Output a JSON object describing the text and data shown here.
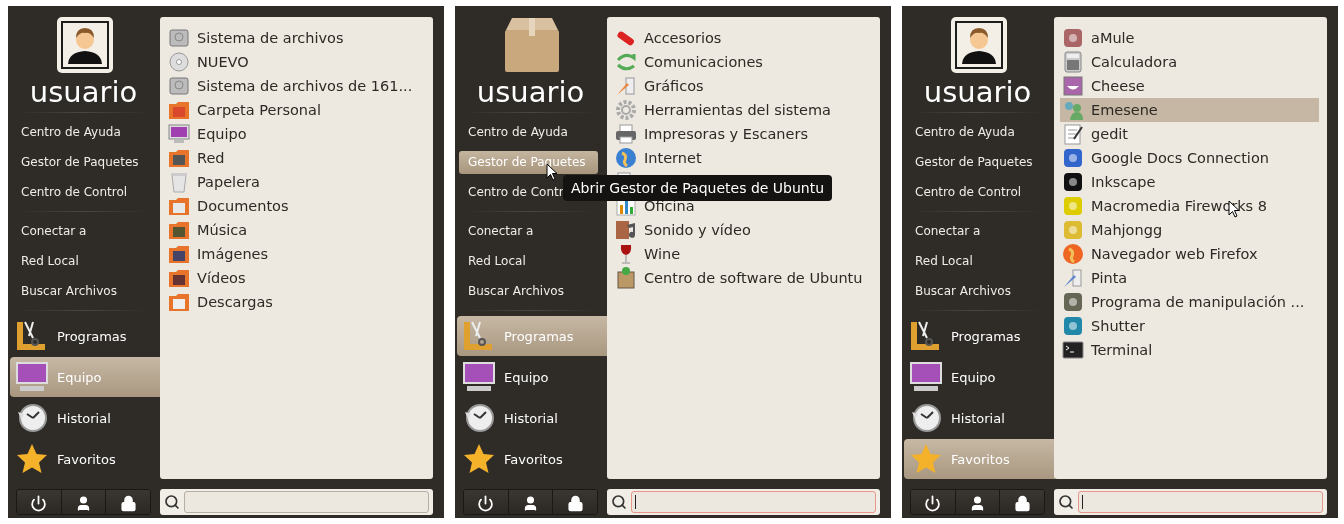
{
  "panels": [
    {
      "user": {
        "name": "usuario"
      },
      "place_groups": [
        [
          {
            "label": "Centro de Ayuda",
            "selected": false,
            "pointer": false
          },
          {
            "label": "Gestor de Paquetes",
            "selected": false,
            "pointer": false
          },
          {
            "label": "Centro de Control",
            "selected": false,
            "pointer": false
          }
        ],
        [
          {
            "label": "Conectar a",
            "selected": false,
            "pointer": false
          },
          {
            "label": "Red Local",
            "selected": false,
            "pointer": false
          },
          {
            "label": "Buscar Archivos",
            "selected": false,
            "pointer": false
          }
        ]
      ],
      "categories": [
        {
          "label": "Programas",
          "selected": false
        },
        {
          "label": "Equipo",
          "selected": true
        },
        {
          "label": "Historial",
          "selected": false
        },
        {
          "label": "Favoritos",
          "selected": false
        }
      ],
      "items": [
        {
          "label": "Sistema de archivos",
          "selected": false,
          "pointer": false
        },
        {
          "label": "NUEVO",
          "selected": false,
          "pointer": false
        },
        {
          "label": "Sistema de archivos de 161...",
          "selected": false,
          "pointer": false
        },
        {
          "label": "Carpeta Personal",
          "selected": false,
          "pointer": false
        },
        {
          "label": "Equipo",
          "selected": false,
          "pointer": false
        },
        {
          "label": "Red",
          "selected": false,
          "pointer": false
        },
        {
          "label": "Papelera",
          "selected": false,
          "pointer": false
        },
        {
          "label": "Documentos",
          "selected": false,
          "pointer": false
        },
        {
          "label": "Música",
          "selected": false,
          "pointer": false
        },
        {
          "label": "Imágenes",
          "selected": false,
          "pointer": false
        },
        {
          "label": "Vídeos",
          "selected": false,
          "pointer": false
        },
        {
          "label": "Descargas",
          "selected": false,
          "pointer": false
        }
      ],
      "search": {
        "focused": false
      }
    },
    {
      "user": {
        "name": "usuario"
      },
      "place_groups": [
        [
          {
            "label": "Centro de Ayuda",
            "selected": false,
            "pointer": false
          },
          {
            "label": "Gestor de Paquetes",
            "selected": true,
            "pointer": true
          },
          {
            "label": "Centro de Contr",
            "selected": false,
            "pointer": false
          }
        ],
        [
          {
            "label": "Conectar a",
            "selected": false,
            "pointer": false
          },
          {
            "label": "Red Local",
            "selected": false,
            "pointer": false
          },
          {
            "label": "Buscar Archivos",
            "selected": false,
            "pointer": false
          }
        ]
      ],
      "categories": [
        {
          "label": "Programas",
          "selected": true
        },
        {
          "label": "Equipo",
          "selected": false
        },
        {
          "label": "Historial",
          "selected": false
        },
        {
          "label": "Favoritos",
          "selected": false
        }
      ],
      "items": [
        {
          "label": "Accesorios",
          "selected": false,
          "pointer": false
        },
        {
          "label": "Comunicaciones",
          "selected": false,
          "pointer": false
        },
        {
          "label": "Gráficos",
          "selected": false,
          "pointer": false
        },
        {
          "label": "Herramientas del sistema",
          "selected": false,
          "pointer": false
        },
        {
          "label": "Impresoras y Escaners",
          "selected": false,
          "pointer": false
        },
        {
          "label": "Internet",
          "selected": false,
          "pointer": false
        },
        {
          "selected": false,
          "pointer": false
        },
        {
          "label": "Oficina",
          "selected": false,
          "pointer": false
        },
        {
          "label": "Sonido y vídeo",
          "selected": false,
          "pointer": false
        },
        {
          "label": "Wine",
          "selected": false,
          "pointer": false
        },
        {
          "label": "Centro de software de Ubuntu",
          "selected": false,
          "pointer": false
        }
      ],
      "tooltip": "Abrir Gestor de Paquetes de Ubuntu",
      "search": {
        "focused": true
      }
    },
    {
      "user": {
        "name": "usuario"
      },
      "place_groups": [
        [
          {
            "label": "Centro de Ayuda",
            "selected": false,
            "pointer": false
          },
          {
            "label": "Gestor de Paquetes",
            "selected": false,
            "pointer": false
          },
          {
            "label": "Centro de Control",
            "selected": false,
            "pointer": false
          }
        ],
        [
          {
            "label": "Conectar a",
            "selected": false,
            "pointer": false
          },
          {
            "label": "Red Local",
            "selected": false,
            "pointer": false
          },
          {
            "label": "Buscar Archivos",
            "selected": false,
            "pointer": false
          }
        ]
      ],
      "categories": [
        {
          "label": "Programas",
          "selected": false
        },
        {
          "label": "Equipo",
          "selected": false
        },
        {
          "label": "Historial",
          "selected": false
        },
        {
          "label": "Favoritos",
          "selected": true
        }
      ],
      "items": [
        {
          "label": "aMule",
          "selected": false,
          "pointer": false
        },
        {
          "label": "Calculadora",
          "selected": false,
          "pointer": false
        },
        {
          "label": "Cheese",
          "selected": false,
          "pointer": false
        },
        {
          "label": "Emesene",
          "selected": true,
          "pointer": false
        },
        {
          "label": "gedit",
          "selected": false,
          "pointer": false
        },
        {
          "label": "Google Docs Connection",
          "selected": false,
          "pointer": false
        },
        {
          "label": "Inkscape",
          "selected": false,
          "pointer": false
        },
        {
          "label": "Macromedia Fireworks 8",
          "selected": false,
          "pointer": true
        },
        {
          "label": "Mahjongg",
          "selected": false,
          "pointer": false
        },
        {
          "label": "Navegador web Firefox",
          "selected": false,
          "pointer": false
        },
        {
          "label": "Pinta",
          "selected": false,
          "pointer": false
        },
        {
          "label": "Programa de manipulación ...",
          "selected": false,
          "pointer": false
        },
        {
          "label": "Shutter",
          "selected": false,
          "pointer": false
        },
        {
          "label": "Terminal",
          "selected": false,
          "pointer": false
        }
      ],
      "search": {
        "focused": true
      }
    }
  ]
}
